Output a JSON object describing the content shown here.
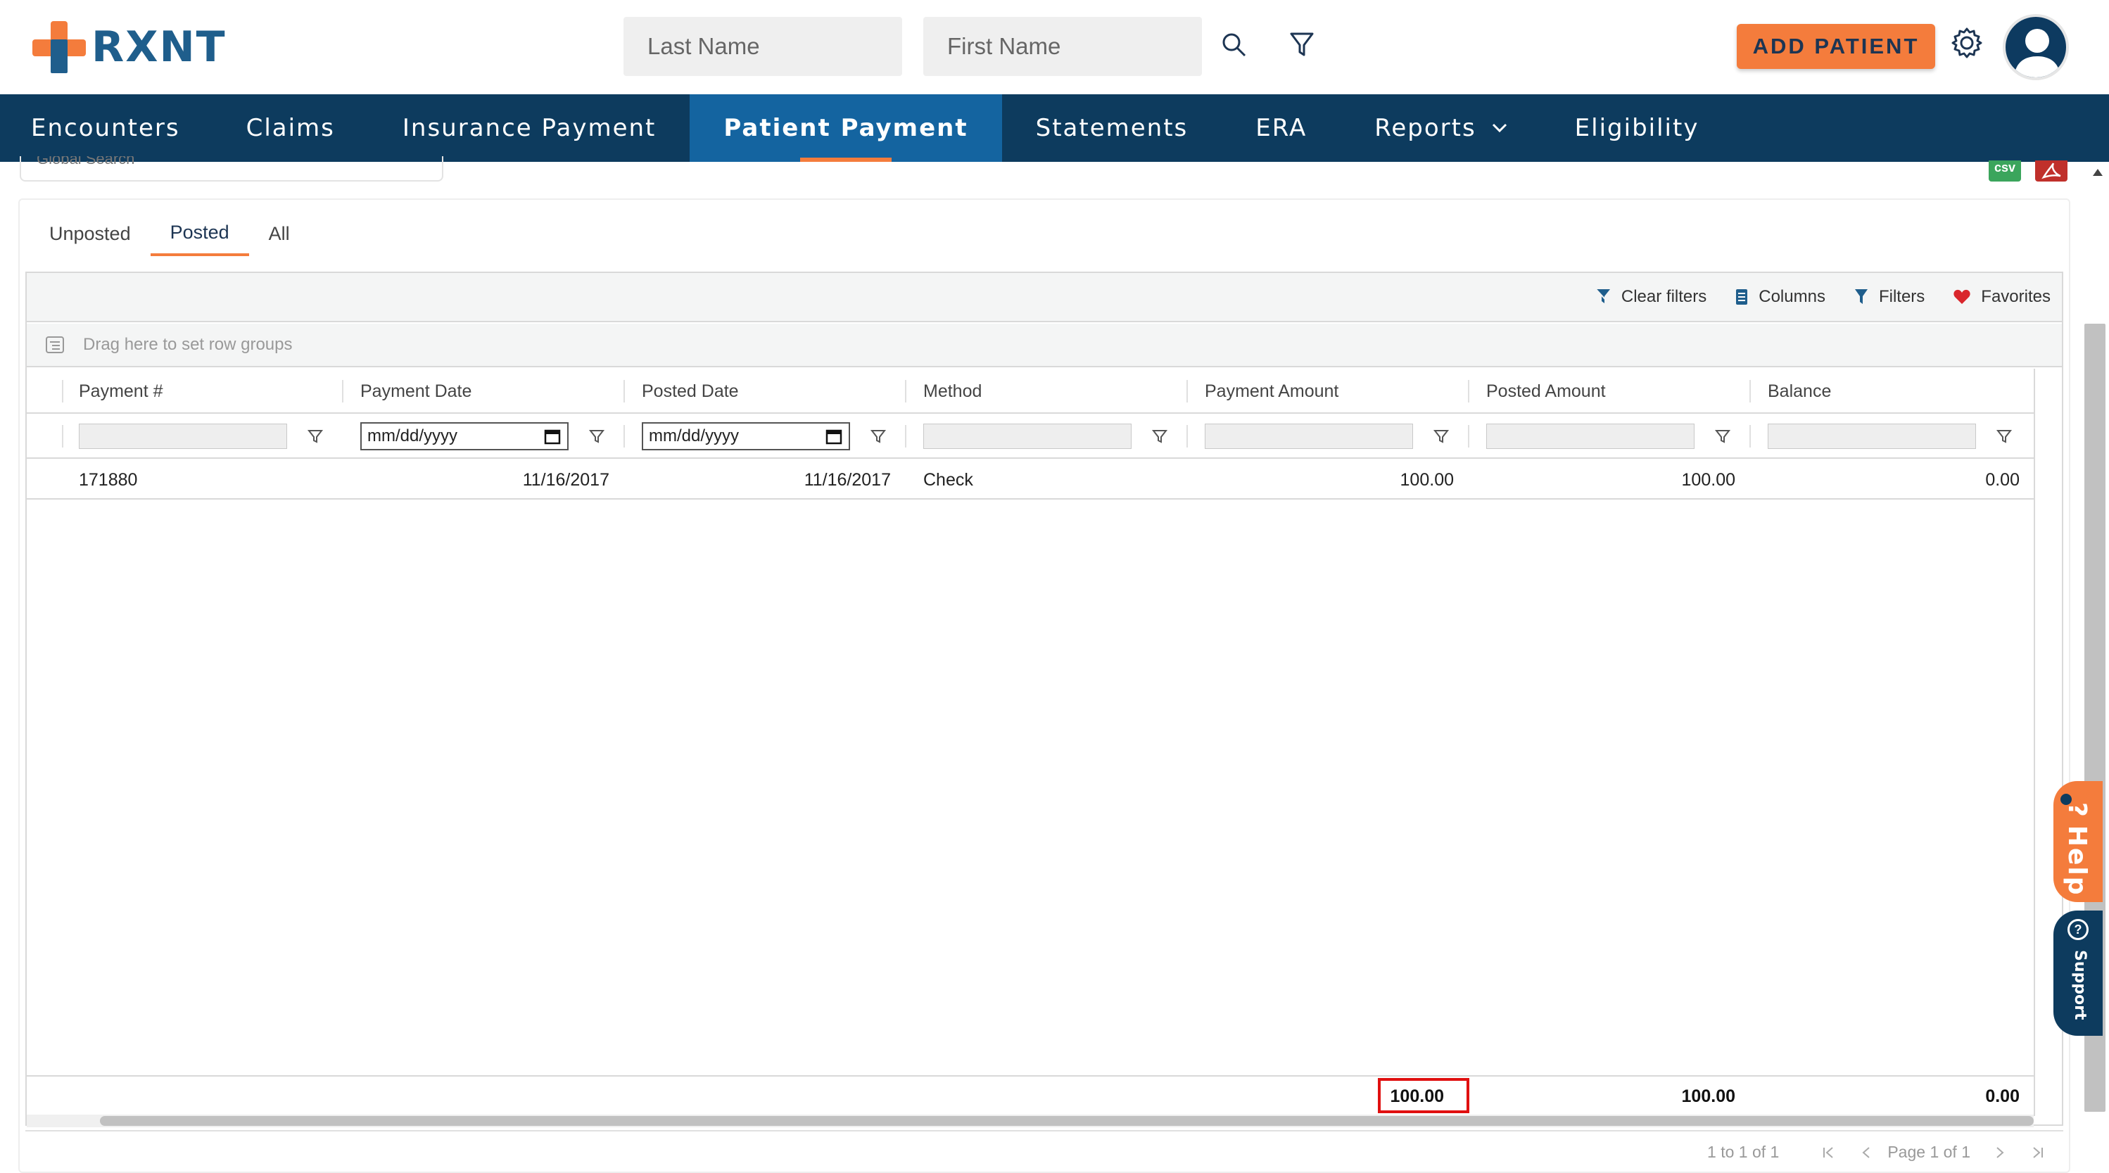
{
  "header": {
    "logo_text": "RXNT",
    "last_name_placeholder": "Last Name",
    "first_name_placeholder": "First Name",
    "add_patient_label": "ADD PATIENT",
    "search_icon": "search-icon",
    "filter_icon": "filter-icon",
    "settings_icon": "gear-icon",
    "avatar_icon": "user-avatar-icon"
  },
  "nav": {
    "items": [
      {
        "label": "Encounters"
      },
      {
        "label": "Claims"
      },
      {
        "label": "Insurance Payment"
      },
      {
        "label": "Patient Payment",
        "active": true
      },
      {
        "label": "Statements"
      },
      {
        "label": "ERA"
      },
      {
        "label": "Reports",
        "has_dropdown": true
      },
      {
        "label": "Eligibility"
      }
    ]
  },
  "toolbar_top": {
    "global_search_placeholder": "Global Search",
    "csv_label": "csv"
  },
  "tabs": [
    {
      "label": "Unposted"
    },
    {
      "label": "Posted",
      "active": true
    },
    {
      "label": "All"
    }
  ],
  "grid": {
    "tools": {
      "clear_filters": "Clear filters",
      "columns": "Columns",
      "filters": "Filters",
      "favorites": "Favorites"
    },
    "group_panel_text": "Drag here to set row groups",
    "columns": [
      "Payment #",
      "Payment Date",
      "Posted Date",
      "Method",
      "Payment Amount",
      "Posted Amount",
      "Balance"
    ],
    "date_placeholder": "mm/dd/yyyy",
    "rows": [
      {
        "payment_no": "171880",
        "payment_date": "11/16/2017",
        "posted_date": "11/16/2017",
        "method": "Check",
        "payment_amount": "100.00",
        "posted_amount": "100.00",
        "balance": "0.00"
      }
    ],
    "totals": {
      "payment_amount": "100.00",
      "posted_amount": "100.00",
      "balance": "0.00"
    },
    "pager": {
      "summary": "1 to 1 of 1",
      "page_text": "Page 1 of 1"
    }
  },
  "widgets": {
    "help_label": "Help",
    "support_label": "Support"
  },
  "colors": {
    "brand_orange": "#f47c3c",
    "brand_navy": "#0d3b5e",
    "nav_active": "#1464a0",
    "highlight_red": "#e01010"
  }
}
